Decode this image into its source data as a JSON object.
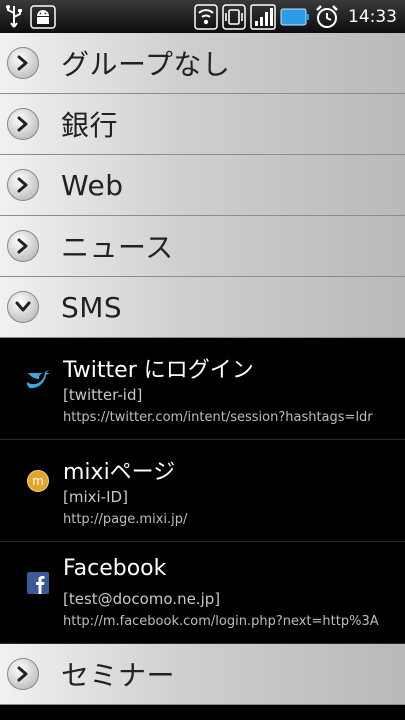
{
  "status_bar": {
    "time": "14:33",
    "icons": [
      "usb-icon",
      "android-debug-icon",
      "wifi-icon",
      "vibrate-icon",
      "signal-icon",
      "battery-icon",
      "alarm-icon"
    ]
  },
  "groups": [
    {
      "label": "グループなし",
      "expanded": false
    },
    {
      "label": "銀行",
      "expanded": false
    },
    {
      "label": "Web",
      "expanded": false
    },
    {
      "label": "ニュース",
      "expanded": false
    },
    {
      "label": "SMS",
      "expanded": true
    },
    {
      "label": "セミナー",
      "expanded": false
    }
  ],
  "sms_items": [
    {
      "icon": "twitter-bird-icon",
      "title": "Twitter にログイン",
      "user": "[twitter-id]",
      "url": "https://twitter.com/intent/session?hashtags=ldr"
    },
    {
      "icon": "mixi-logo-icon",
      "title": "mixiページ",
      "user": "[mixi-ID]",
      "url": "http://page.mixi.jp/"
    },
    {
      "icon": "facebook-logo-icon",
      "title": "Facebook",
      "user": "[test@docomo.ne.jp]",
      "url": "http://m.facebook.com/login.php?next=http%3A"
    }
  ],
  "colors": {
    "status_bar": "#1c1c1c",
    "row_light": "#f1f1f1",
    "row_dark": "#b9b9b9",
    "battery": "#2e9be6",
    "twitter": "#39a9e0",
    "mixi": "#e3a42b",
    "facebook": "#3b5998"
  }
}
